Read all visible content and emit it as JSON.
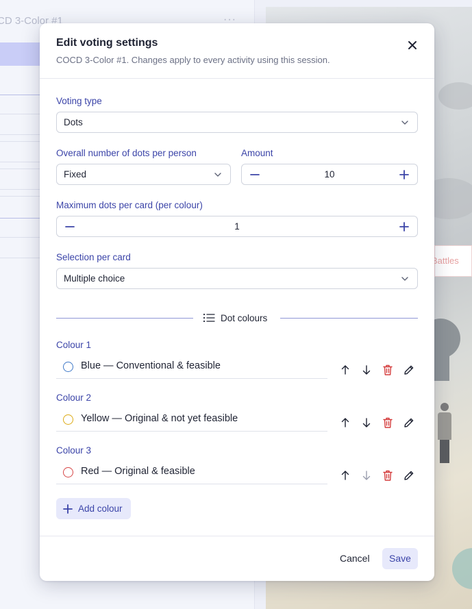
{
  "background": {
    "session_title": "CD 3-Color #1",
    "more_icon": "ellipsis-icon",
    "card_text": "Battles"
  },
  "modal": {
    "title": "Edit voting settings",
    "subtitle": "COCD 3-Color #1. Changes apply to every activity using this session.",
    "close_icon": "close-icon",
    "voting_type": {
      "label": "Voting type",
      "value": "Dots"
    },
    "dots_per_person": {
      "label": "Overall number of dots per person",
      "value": "Fixed"
    },
    "amount": {
      "label": "Amount",
      "value": "10"
    },
    "max_dots": {
      "label": "Maximum dots per card (per colour)",
      "value": "1"
    },
    "selection": {
      "label": "Selection per card",
      "value": "Multiple choice"
    },
    "dot_colours_label": "Dot colours",
    "colours": [
      {
        "label": "Colour 1",
        "name": "Blue — Conventional & feasible",
        "color": "#3f79c8"
      },
      {
        "label": "Colour 2",
        "name": "Yellow — Original & not yet feasible",
        "color": "#dcaa14"
      },
      {
        "label": "Colour 3",
        "name": "Red — Original & feasible",
        "color": "#d64545"
      }
    ],
    "add_colour": "Add colour",
    "cancel": "Cancel",
    "save": "Save"
  },
  "colors": {
    "accent": "#3b44a8",
    "accent_soft": "#e7e9fb",
    "delete": "#d43b3b"
  }
}
